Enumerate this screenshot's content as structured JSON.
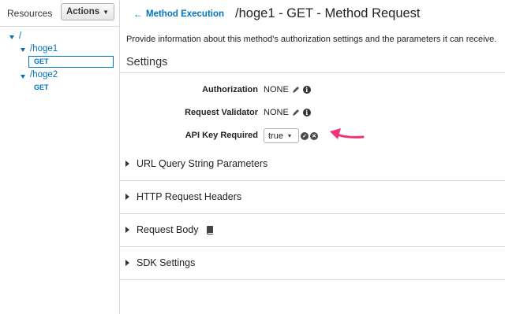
{
  "sidebar": {
    "resources_label": "Resources",
    "actions_label": "Actions",
    "tree": {
      "root": "/",
      "hoge1": "/hoge1",
      "hoge1_method": "GET",
      "hoge2": "/hoge2",
      "hoge2_method": "GET"
    }
  },
  "header": {
    "back_label": "Method Execution",
    "title": "/hoge1 - GET - Method Request"
  },
  "main": {
    "description": "Provide information about this method's authorization settings and the parameters it can receive.",
    "settings_title": "Settings",
    "settings": {
      "authorization_label": "Authorization",
      "authorization_value": "NONE",
      "validator_label": "Request Validator",
      "validator_value": "NONE",
      "api_key_label": "API Key Required",
      "api_key_value": "true"
    },
    "sections": {
      "query": "URL Query String Parameters",
      "headers": "HTTP Request Headers",
      "body": "Request Body",
      "sdk": "SDK Settings"
    }
  },
  "colors": {
    "link": "#0073bb",
    "annotation_arrow": "#f0337a",
    "border": "#d5dbdb"
  },
  "icons": [
    "caret-down-icon",
    "arrow-left-icon",
    "pencil-icon",
    "info-icon",
    "check-icon",
    "close-icon",
    "expand-triangle-icon",
    "book-icon"
  ]
}
